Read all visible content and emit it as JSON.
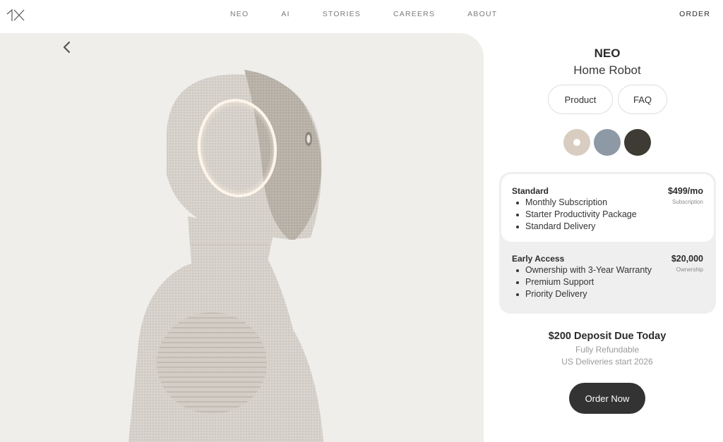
{
  "brand": {
    "logo_icon": "1x-logo-icon"
  },
  "nav": {
    "items": [
      {
        "label": "NEO"
      },
      {
        "label": "AI"
      },
      {
        "label": "STORIES"
      },
      {
        "label": "CAREERS"
      },
      {
        "label": "ABOUT"
      }
    ],
    "order_label": "ORDER"
  },
  "hero": {
    "back_icon": "chevron-left-icon",
    "image": "neo-robot-profile-image"
  },
  "product": {
    "title": "NEO",
    "subtitle": "Home Robot",
    "tabs": [
      {
        "label": "Product"
      },
      {
        "label": "FAQ"
      }
    ],
    "colors": [
      "#d8cdc0",
      "#8d9aa5",
      "#3d3b33"
    ],
    "selected_color_index": 0
  },
  "plans": [
    {
      "name": "Standard",
      "price": "$499/mo",
      "type": "Subscription",
      "features": [
        "Monthly Subscription",
        "Starter Productivity Package",
        "Standard Delivery"
      ]
    },
    {
      "name": "Early Access",
      "price": "$20,000",
      "type": "Ownership",
      "features": [
        "Ownership with 3-Year Warranty",
        "Premium Support",
        "Priority Delivery"
      ]
    }
  ],
  "checkout": {
    "deposit": "$200 Deposit Due Today",
    "refund": "Fully Refundable",
    "delivery": "US Deliveries start 2026",
    "order_button": "Order Now"
  }
}
